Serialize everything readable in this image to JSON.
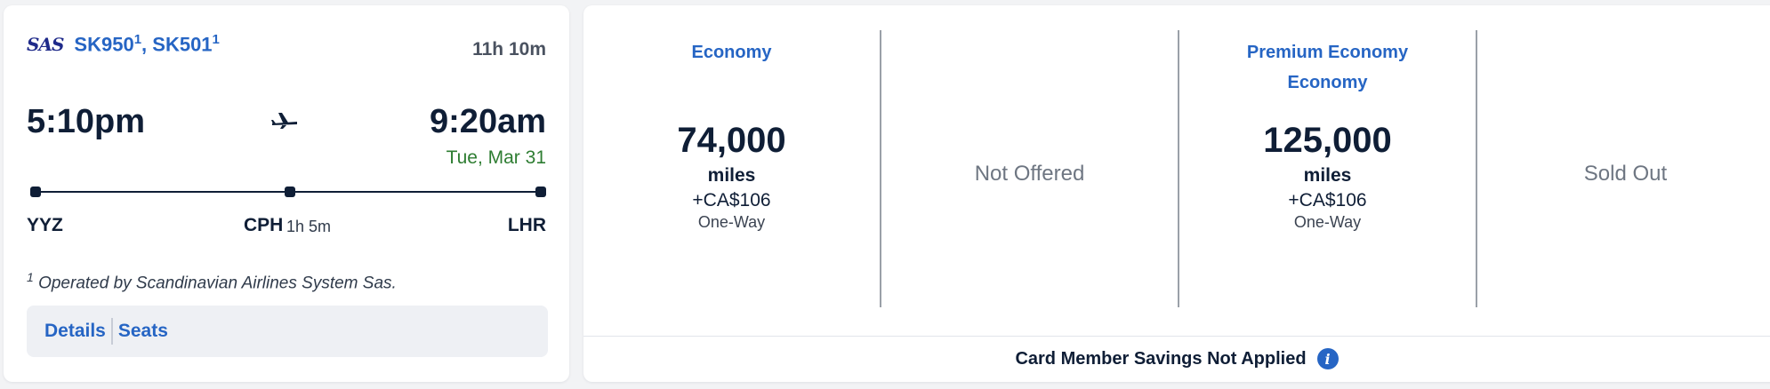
{
  "flight": {
    "airline_logo": "SAS",
    "flight_1": "SK950",
    "flight_2": "SK501",
    "footnote_mark": "1",
    "separator": ", ",
    "duration": "11h 10m",
    "departure_time": "5:10pm",
    "arrival_time": "9:20am",
    "arrival_date": "Tue, Mar 31",
    "origin": "YYZ",
    "connection": "CPH",
    "layover": "1h 5m",
    "destination": "LHR",
    "operated_by": "Operated by Scandinavian Airlines System Sas.",
    "links": {
      "details": "Details",
      "seats": "Seats"
    }
  },
  "fares": [
    {
      "cabin_lines": [
        "Economy"
      ],
      "miles": "74,000",
      "miles_word": "miles",
      "fee": "+CA$106",
      "trip_type": "One-Way"
    },
    {
      "status": "Not Offered"
    },
    {
      "cabin_lines": [
        "Premium Economy",
        "Economy"
      ],
      "miles": "125,000",
      "miles_word": "miles",
      "fee": "+CA$106",
      "trip_type": "One-Way"
    },
    {
      "status": "Sold Out"
    }
  ],
  "footer": {
    "text": "Card Member Savings Not Applied",
    "info_icon": "info-icon"
  },
  "colors": {
    "accent": "#2665c4",
    "date_green": "#2e7d32",
    "text_dark": "#0f1e36",
    "muted": "#6e7682"
  }
}
